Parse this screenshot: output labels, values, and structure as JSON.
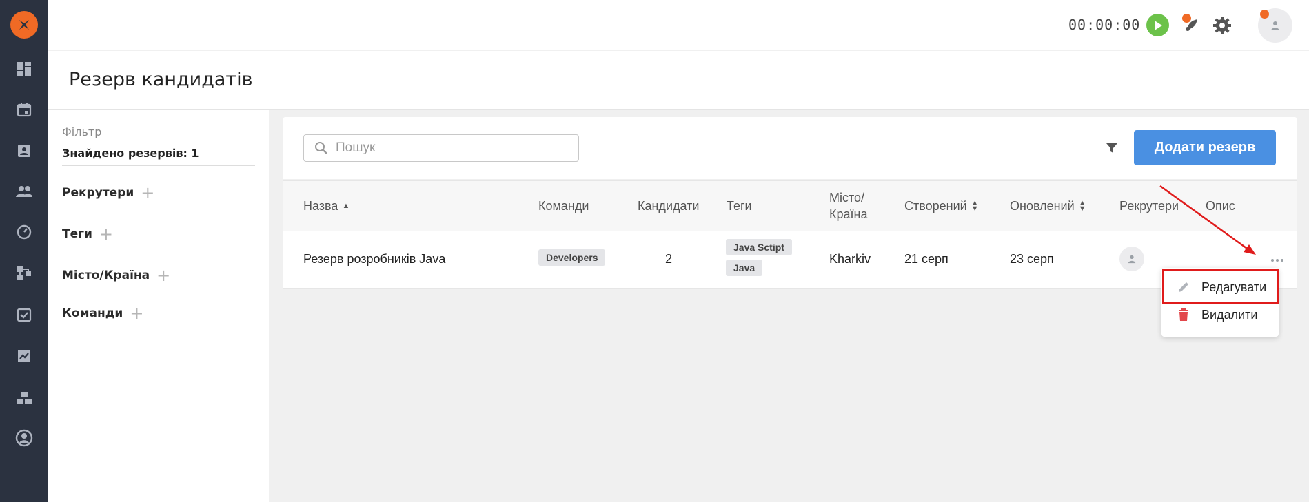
{
  "app": {
    "nav_items": [
      "dashboard-icon",
      "calendar-icon",
      "contacts-icon",
      "users-icon",
      "speedometer-icon",
      "workflow-icon",
      "tasks-icon",
      "analytics-icon",
      "boxes-icon",
      "profile-icon"
    ]
  },
  "topbar": {
    "timer": "00:00:00"
  },
  "page": {
    "title": "Резерв кандидатів"
  },
  "filter": {
    "label": "Фільтр",
    "found": "Знайдено резервів: 1",
    "items": [
      "Рекрутери",
      "Теги",
      "Місто/Країна",
      "Команди"
    ]
  },
  "toolbar": {
    "search_placeholder": "Пошук",
    "add_label": "Додати резерв"
  },
  "table": {
    "headers": {
      "name": "Назва",
      "teams": "Команди",
      "candidates": "Кандидати",
      "tags": "Теги",
      "city_line1": "Місто/",
      "city_line2": "Країна",
      "created": "Створений",
      "updated": "Оновлений",
      "recruiters": "Рекрутери",
      "description": "Опис"
    },
    "rows": [
      {
        "name": "Резерв розробників Java",
        "team": "Developers",
        "candidates": "2",
        "tags": [
          "Java Sctipt",
          "Java"
        ],
        "city": "Kharkiv",
        "created": "21 серп",
        "updated": "23 серп"
      }
    ]
  },
  "menu": {
    "edit": "Редагувати",
    "delete": "Видалити"
  },
  "colors": {
    "nav_bg": "#2b3240",
    "accent": "#4a90e2",
    "brand": "#f06a25",
    "play": "#6cc24a",
    "delete": "#e2474b",
    "highlight": "#e01b1b"
  }
}
